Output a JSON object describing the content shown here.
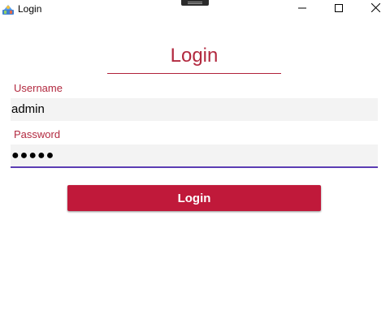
{
  "window": {
    "title": "Login",
    "app_icon": "app-icon",
    "controls": {
      "minimize_icon": "minimize-icon",
      "maximize_icon": "maximize-icon",
      "close_icon": "close-icon"
    }
  },
  "form": {
    "heading": "Login",
    "username": {
      "label": "Username",
      "value": "admin"
    },
    "password": {
      "label": "Password",
      "value": "●●●●●"
    },
    "submit_label": "Login"
  },
  "colors": {
    "accent": "#b2293f",
    "button": "#c0193a",
    "focus_underline": "#5b3db3",
    "field_background": "#f3f3f3"
  }
}
